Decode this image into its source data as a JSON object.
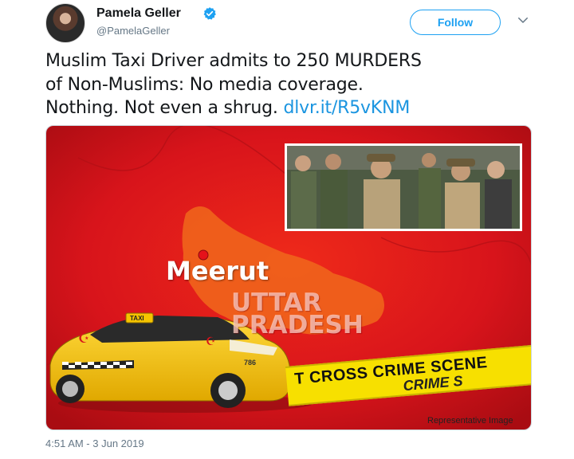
{
  "author": {
    "name": "Pamela Geller",
    "handle": "@PamelaGeller",
    "verified": true,
    "avatar_icon": "avatar-photo"
  },
  "actions": {
    "follow_label": "Follow",
    "menu_icon": "chevron-down-icon"
  },
  "tweet": {
    "text_lines": [
      "Muslim Taxi Driver admits to 250 MURDERS",
      "of Non-Muslims: No media coverage.",
      "Nothing. Not even a shrug."
    ],
    "link": "dlvr.it/R5vKNM",
    "timestamp": "4:51 AM - 3 Jun 2019"
  },
  "media": {
    "city_label": "Meerut",
    "state_label_line1": "UTTAR",
    "state_label_line2": "PRADESH",
    "tape_text": "T CROSS  CRIME SCENE",
    "tape_text_2": "CRIME S",
    "taxi_sign": "TAXI",
    "taxi_number": "786",
    "caption": "Representative Image"
  },
  "colors": {
    "accent": "#1da1f2",
    "link": "#1b95e0",
    "map_red": "#d8141b",
    "taxi_yellow": "#f5c400",
    "tape_yellow": "#f7e000"
  }
}
